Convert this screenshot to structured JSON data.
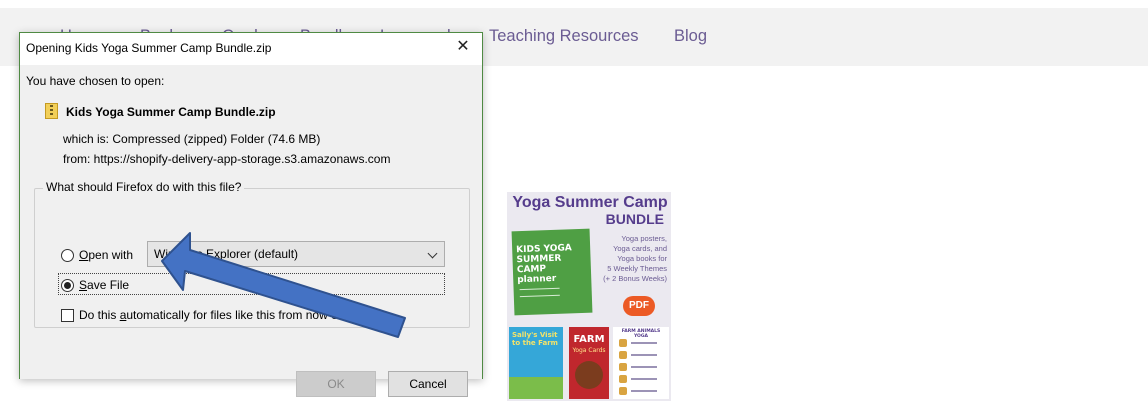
{
  "site_nav": {
    "items": [
      "Home",
      "Books",
      "Cards",
      "Bundles",
      "Lesson plans",
      "Teaching Resources",
      "Blog"
    ]
  },
  "product": {
    "title_line1": "Yoga Summer Camp",
    "title_line2": "BUNDLE",
    "book_title": "KIDS YOGA SUMMER CAMP planner",
    "features": [
      "Yoga posters,",
      "Yoga cards, and",
      "Yoga books for",
      "5 Weekly Themes",
      "(+ 2 Bonus Weeks)"
    ],
    "badge": "PDF",
    "book2_title": "Sally's Visit to the Farm",
    "book3_title": "FARM",
    "book3_sub": "Yoga Cards",
    "book4_title": "FARM ANIMALS YOGA"
  },
  "dialog": {
    "title": "Opening Kids Yoga Summer Camp Bundle.zip",
    "close_glyph": "✕",
    "you_have_chosen": "You have chosen to open:",
    "file_name": "Kids Yoga Summer Camp Bundle.zip",
    "which_is": "which is:  Compressed (zipped) Folder (74.6 MB)",
    "from": "from:  https://shopify-delivery-app-storage.s3.amazonaws.com",
    "question": "What should Firefox do with this file?",
    "open_with_underline": "O",
    "open_with_rest": "pen with",
    "open_with_app": "Windows Explorer (default)",
    "save_file_underline": "S",
    "save_file_rest": "ave File",
    "auto_prefix": "Do this ",
    "auto_underline": "a",
    "auto_rest": "utomatically for files like this from now on.",
    "ok_label": "OK",
    "cancel_label": "Cancel",
    "selected_option": "Save File"
  },
  "colors": {
    "nav_text": "#6b5c93",
    "arrow_fill": "#4472c4",
    "arrow_stroke": "#2f528f"
  }
}
